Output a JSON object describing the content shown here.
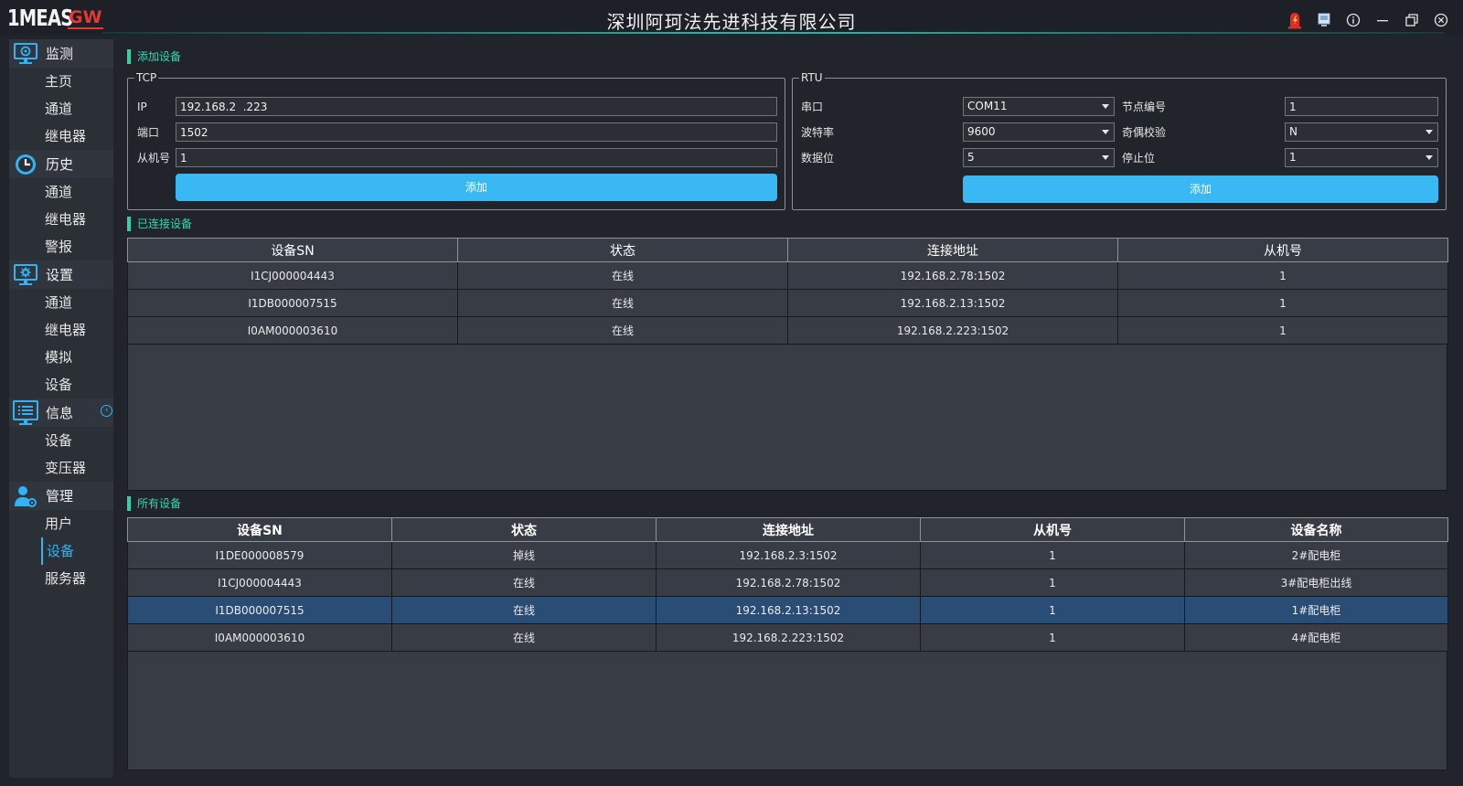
{
  "app": {
    "logo_main": "1MEAS",
    "logo_accent": "GW",
    "title": "深圳阿珂法先进科技有限公司"
  },
  "window_buttons": [
    {
      "name": "alarm-icon"
    },
    {
      "name": "screen-icon"
    },
    {
      "name": "info-icon"
    },
    {
      "name": "minimize-icon"
    },
    {
      "name": "restore-icon"
    },
    {
      "name": "close-icon"
    }
  ],
  "sidebar": {
    "groups": [
      {
        "label": "监测",
        "icon": "monitor-icon",
        "items": [
          "主页",
          "通道",
          "继电器"
        ]
      },
      {
        "label": "历史",
        "icon": "clock-icon",
        "items": [
          "通道",
          "继电器",
          "警报"
        ]
      },
      {
        "label": "设置",
        "icon": "settings-screen-icon",
        "items": [
          "通道",
          "继电器",
          "模拟",
          "设备"
        ]
      },
      {
        "label": "信息",
        "icon": "list-screen-icon",
        "items": [
          "设备",
          "变压器"
        ]
      },
      {
        "label": "管理",
        "icon": "user-gear-icon",
        "items": [
          "用户",
          "设备",
          "服务器"
        ]
      }
    ],
    "active_item": "管理/设备",
    "collapse_icon": "chevron-left-circle-icon"
  },
  "add_device": {
    "title": "添加设备",
    "tcp": {
      "label": "TCP",
      "ip_label": "IP",
      "ip_value": "192.168.2  .223",
      "port_label": "端口",
      "port_value": "1502",
      "slave_label": "从机号",
      "slave_value": "1",
      "add_label": "添加"
    },
    "rtu": {
      "label": "RTU",
      "serial_label": "串口",
      "serial_value": "COM11",
      "node_label": "节点编号",
      "node_value": "1",
      "baud_label": "波特率",
      "baud_value": "9600",
      "parity_label": "奇偶校验",
      "parity_value": "N",
      "databits_label": "数据位",
      "databits_value": "5",
      "stopbits_label": "停止位",
      "stopbits_value": "1",
      "add_label": "添加"
    }
  },
  "connected": {
    "title": "已连接设备",
    "headers": [
      "设备SN",
      "状态",
      "连接地址",
      "从机号"
    ],
    "rows": [
      [
        "I1CJ000004443",
        "在线",
        "192.168.2.78:1502",
        "1"
      ],
      [
        "I1DB000007515",
        "在线",
        "192.168.2.13:1502",
        "1"
      ],
      [
        "I0AM000003610",
        "在线",
        "192.168.2.223:1502",
        "1"
      ]
    ]
  },
  "all_devices": {
    "title": "所有设备",
    "headers": [
      "设备SN",
      "状态",
      "连接地址",
      "从机号",
      "设备名称"
    ],
    "rows": [
      [
        "I1DE000008579",
        "掉线",
        "192.168.2.3:1502",
        "1",
        "2#配电柜"
      ],
      [
        "I1CJ000004443",
        "在线",
        "192.168.2.78:1502",
        "1",
        "3#配电柜出线"
      ],
      [
        "I1DB000007515",
        "在线",
        "192.168.2.13:1502",
        "1",
        "1#配电柜"
      ],
      [
        "I0AM000003610",
        "在线",
        "192.168.2.223:1502",
        "1",
        "4#配电柜"
      ]
    ],
    "selected_row": 2
  },
  "colors": {
    "accent_blue": "#3ab8f4",
    "section_green": "#2fd3a3",
    "alarm_red": "#e53935",
    "selected_row": "#2a4d75"
  }
}
